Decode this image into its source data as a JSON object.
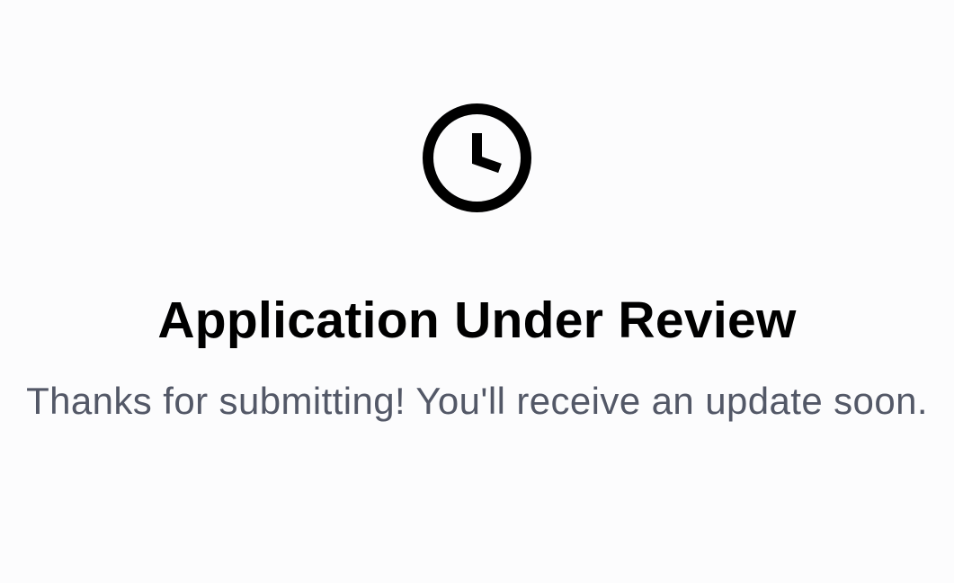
{
  "status_screen": {
    "icon": "clock-icon",
    "title": "Application Under Review",
    "message": "Thanks for submitting! You'll receive an update soon."
  },
  "colors": {
    "background": "#fcfcfd",
    "title": "#000000",
    "message": "#535867",
    "icon": "#000000"
  }
}
